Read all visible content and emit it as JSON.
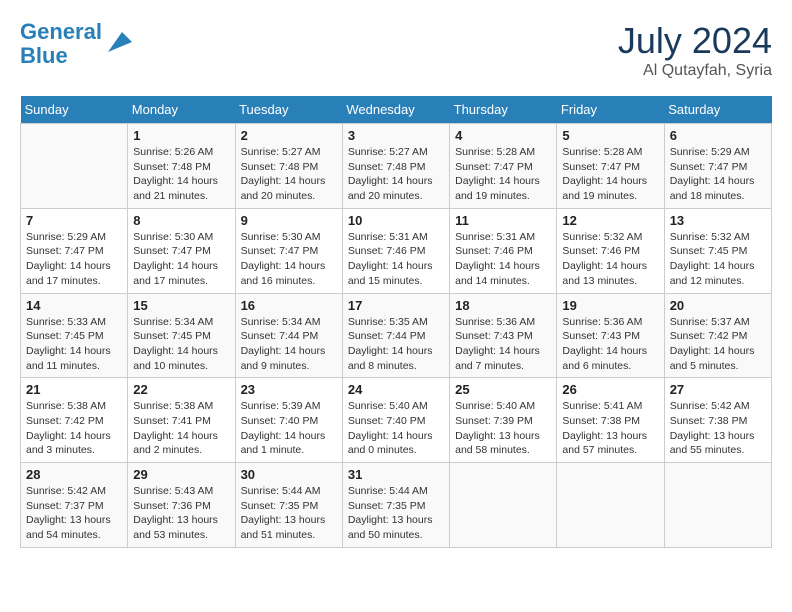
{
  "header": {
    "logo_line1": "General",
    "logo_line2": "Blue",
    "month_year": "July 2024",
    "location": "Al Qutayfah, Syria"
  },
  "columns": [
    "Sunday",
    "Monday",
    "Tuesday",
    "Wednesday",
    "Thursday",
    "Friday",
    "Saturday"
  ],
  "weeks": [
    [
      {
        "day": "",
        "sunrise": "",
        "sunset": "",
        "daylight": ""
      },
      {
        "day": "1",
        "sunrise": "5:26 AM",
        "sunset": "7:48 PM",
        "daylight": "14 hours and 21 minutes."
      },
      {
        "day": "2",
        "sunrise": "5:27 AM",
        "sunset": "7:48 PM",
        "daylight": "14 hours and 20 minutes."
      },
      {
        "day": "3",
        "sunrise": "5:27 AM",
        "sunset": "7:48 PM",
        "daylight": "14 hours and 20 minutes."
      },
      {
        "day": "4",
        "sunrise": "5:28 AM",
        "sunset": "7:47 PM",
        "daylight": "14 hours and 19 minutes."
      },
      {
        "day": "5",
        "sunrise": "5:28 AM",
        "sunset": "7:47 PM",
        "daylight": "14 hours and 19 minutes."
      },
      {
        "day": "6",
        "sunrise": "5:29 AM",
        "sunset": "7:47 PM",
        "daylight": "14 hours and 18 minutes."
      }
    ],
    [
      {
        "day": "7",
        "sunrise": "5:29 AM",
        "sunset": "7:47 PM",
        "daylight": "14 hours and 17 minutes."
      },
      {
        "day": "8",
        "sunrise": "5:30 AM",
        "sunset": "7:47 PM",
        "daylight": "14 hours and 17 minutes."
      },
      {
        "day": "9",
        "sunrise": "5:30 AM",
        "sunset": "7:47 PM",
        "daylight": "14 hours and 16 minutes."
      },
      {
        "day": "10",
        "sunrise": "5:31 AM",
        "sunset": "7:46 PM",
        "daylight": "14 hours and 15 minutes."
      },
      {
        "day": "11",
        "sunrise": "5:31 AM",
        "sunset": "7:46 PM",
        "daylight": "14 hours and 14 minutes."
      },
      {
        "day": "12",
        "sunrise": "5:32 AM",
        "sunset": "7:46 PM",
        "daylight": "14 hours and 13 minutes."
      },
      {
        "day": "13",
        "sunrise": "5:32 AM",
        "sunset": "7:45 PM",
        "daylight": "14 hours and 12 minutes."
      }
    ],
    [
      {
        "day": "14",
        "sunrise": "5:33 AM",
        "sunset": "7:45 PM",
        "daylight": "14 hours and 11 minutes."
      },
      {
        "day": "15",
        "sunrise": "5:34 AM",
        "sunset": "7:45 PM",
        "daylight": "14 hours and 10 minutes."
      },
      {
        "day": "16",
        "sunrise": "5:34 AM",
        "sunset": "7:44 PM",
        "daylight": "14 hours and 9 minutes."
      },
      {
        "day": "17",
        "sunrise": "5:35 AM",
        "sunset": "7:44 PM",
        "daylight": "14 hours and 8 minutes."
      },
      {
        "day": "18",
        "sunrise": "5:36 AM",
        "sunset": "7:43 PM",
        "daylight": "14 hours and 7 minutes."
      },
      {
        "day": "19",
        "sunrise": "5:36 AM",
        "sunset": "7:43 PM",
        "daylight": "14 hours and 6 minutes."
      },
      {
        "day": "20",
        "sunrise": "5:37 AM",
        "sunset": "7:42 PM",
        "daylight": "14 hours and 5 minutes."
      }
    ],
    [
      {
        "day": "21",
        "sunrise": "5:38 AM",
        "sunset": "7:42 PM",
        "daylight": "14 hours and 3 minutes."
      },
      {
        "day": "22",
        "sunrise": "5:38 AM",
        "sunset": "7:41 PM",
        "daylight": "14 hours and 2 minutes."
      },
      {
        "day": "23",
        "sunrise": "5:39 AM",
        "sunset": "7:40 PM",
        "daylight": "14 hours and 1 minute."
      },
      {
        "day": "24",
        "sunrise": "5:40 AM",
        "sunset": "7:40 PM",
        "daylight": "14 hours and 0 minutes."
      },
      {
        "day": "25",
        "sunrise": "5:40 AM",
        "sunset": "7:39 PM",
        "daylight": "13 hours and 58 minutes."
      },
      {
        "day": "26",
        "sunrise": "5:41 AM",
        "sunset": "7:38 PM",
        "daylight": "13 hours and 57 minutes."
      },
      {
        "day": "27",
        "sunrise": "5:42 AM",
        "sunset": "7:38 PM",
        "daylight": "13 hours and 55 minutes."
      }
    ],
    [
      {
        "day": "28",
        "sunrise": "5:42 AM",
        "sunset": "7:37 PM",
        "daylight": "13 hours and 54 minutes."
      },
      {
        "day": "29",
        "sunrise": "5:43 AM",
        "sunset": "7:36 PM",
        "daylight": "13 hours and 53 minutes."
      },
      {
        "day": "30",
        "sunrise": "5:44 AM",
        "sunset": "7:35 PM",
        "daylight": "13 hours and 51 minutes."
      },
      {
        "day": "31",
        "sunrise": "5:44 AM",
        "sunset": "7:35 PM",
        "daylight": "13 hours and 50 minutes."
      },
      {
        "day": "",
        "sunrise": "",
        "sunset": "",
        "daylight": ""
      },
      {
        "day": "",
        "sunrise": "",
        "sunset": "",
        "daylight": ""
      },
      {
        "day": "",
        "sunrise": "",
        "sunset": "",
        "daylight": ""
      }
    ]
  ]
}
